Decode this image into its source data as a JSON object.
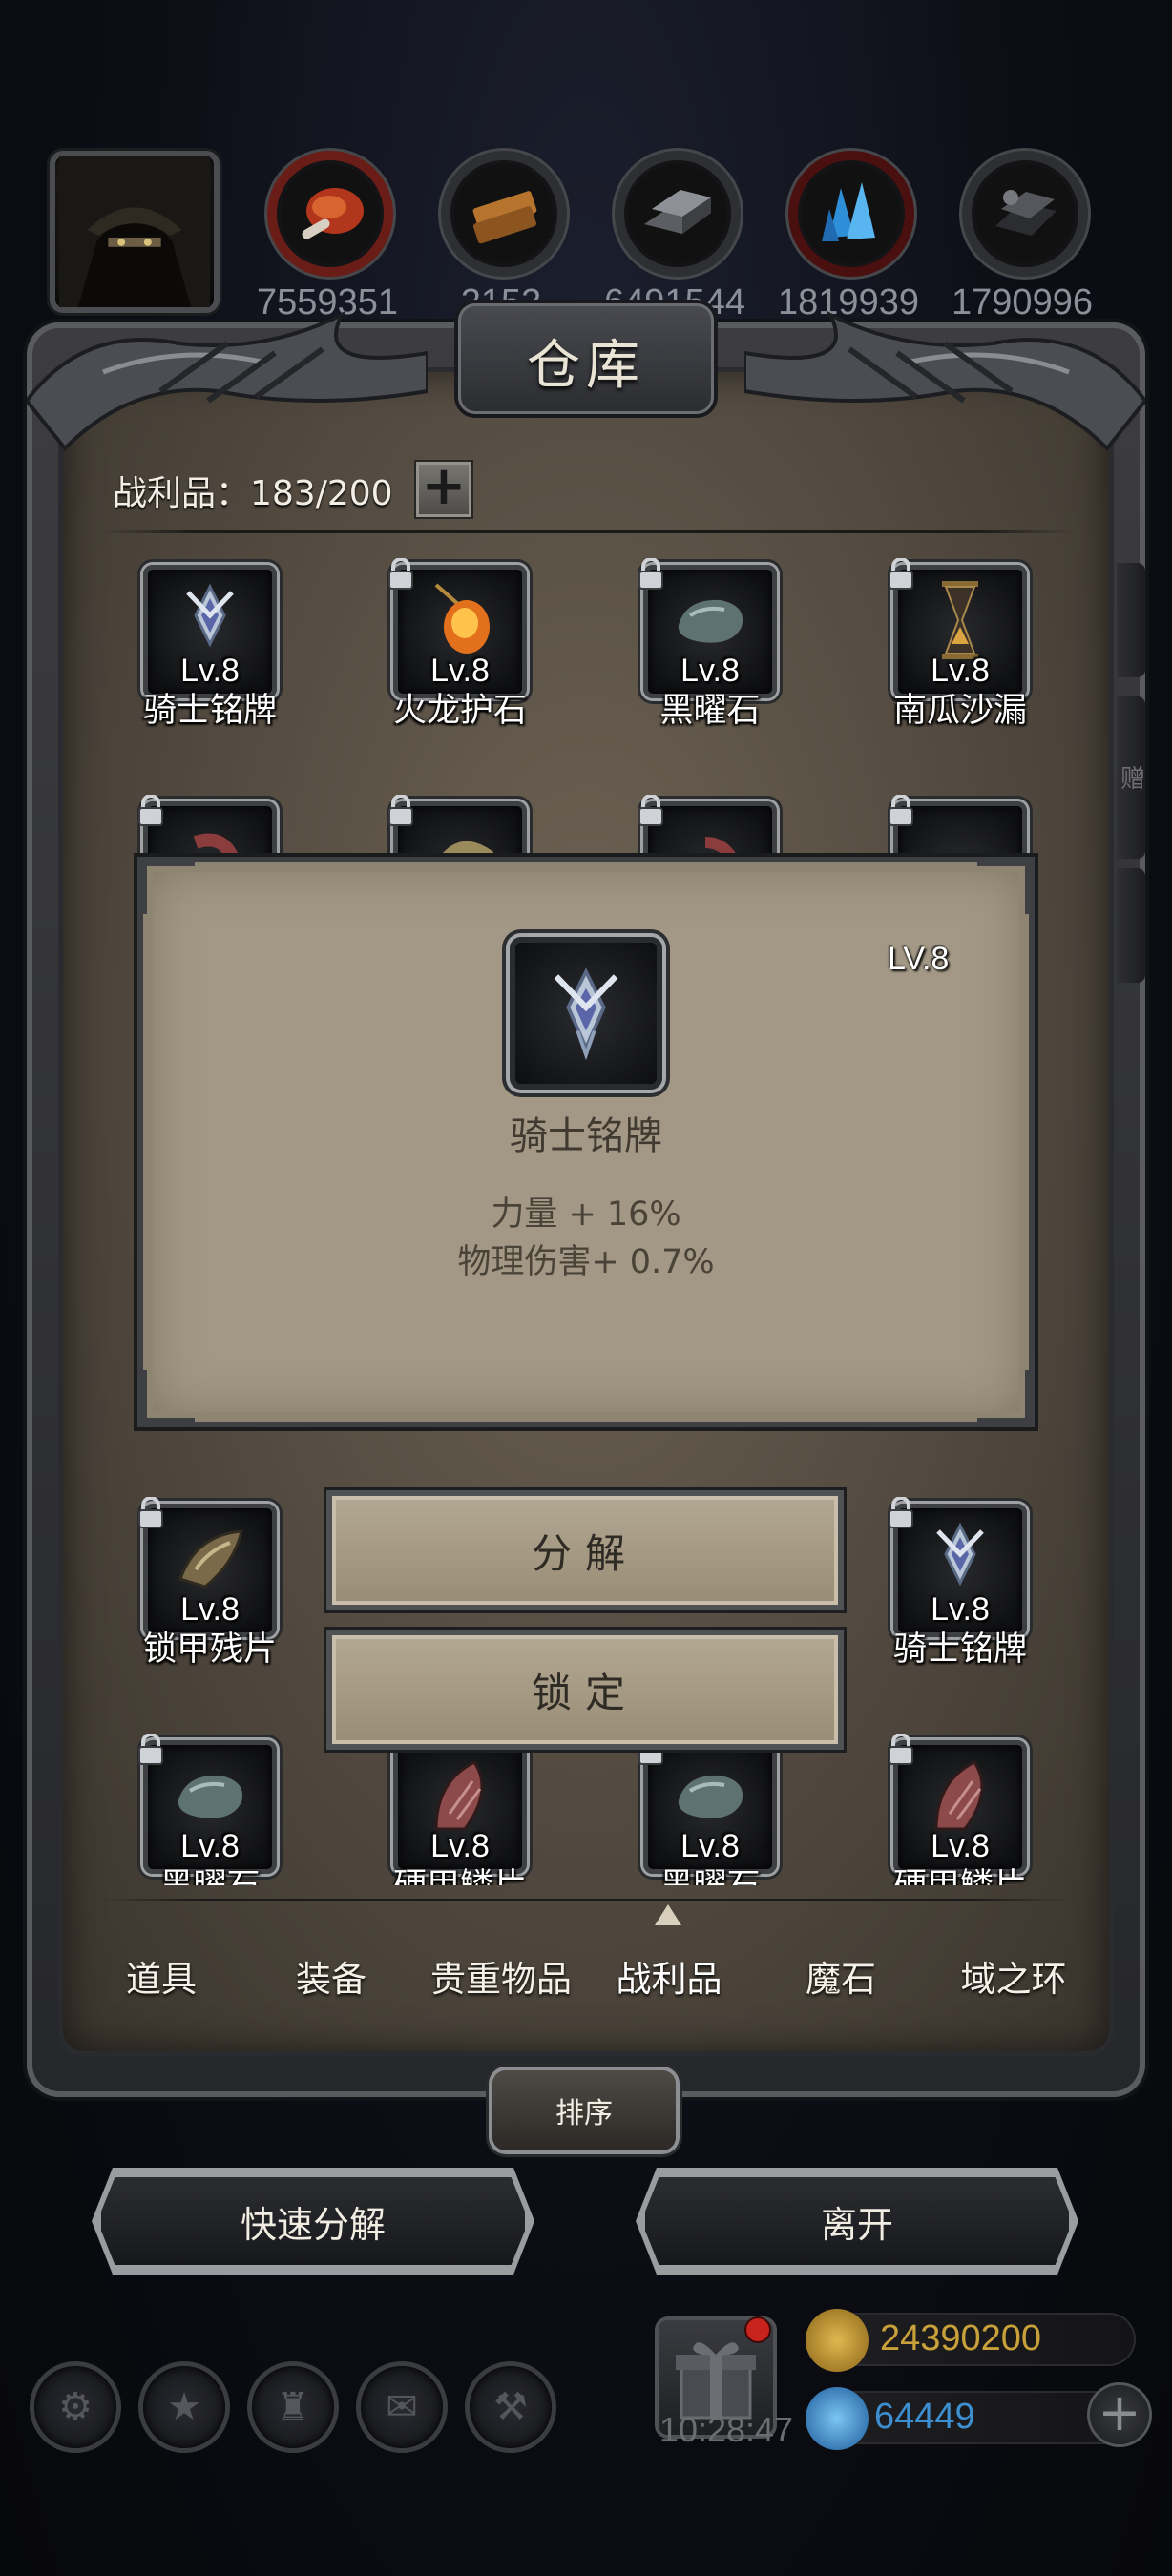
{
  "top_bar": {
    "avatar_icon": "hooded-character-portrait",
    "resources": [
      {
        "icon": "red-meat-resource-icon",
        "value": "7559351"
      },
      {
        "icon": "wood-plank-resource-icon",
        "value": "2153"
      },
      {
        "icon": "iron-ingot-resource-icon",
        "value": "6491544"
      },
      {
        "icon": "blue-crystal-resource-icon",
        "value": "1819939"
      },
      {
        "icon": "dark-ore-resource-icon",
        "value": "1790996"
      }
    ]
  },
  "warehouse": {
    "title": "仓库",
    "capacity_label": "战利品：183/200",
    "expand_symbol": "+",
    "side_tab_label": "赠"
  },
  "items": {
    "row1": [
      {
        "name": "骑士铭牌",
        "level": "Lv.8",
        "icon": "knight-badge-icon",
        "locked": false
      },
      {
        "name": "火龙护石",
        "level": "Lv.8",
        "icon": "fire-dragon-amulet-icon",
        "locked": true
      },
      {
        "name": "黑曜石",
        "level": "Lv.8",
        "icon": "obsidian-stone-icon",
        "locked": true
      },
      {
        "name": "南瓜沙漏",
        "level": "Lv.8",
        "icon": "pumpkin-hourglass-icon",
        "locked": true
      }
    ],
    "row4": [
      {
        "name": "锁甲残片",
        "level": "Lv.8",
        "icon": "chainmail-fragment-icon",
        "locked": true
      },
      {
        "name": "骑士铭牌",
        "level": "Lv.8",
        "icon": "knight-badge-icon",
        "locked": true
      }
    ],
    "row5": [
      {
        "name": "黑曜石",
        "level": "Lv.8",
        "icon": "obsidian-stone-icon",
        "locked": true
      },
      {
        "name": "硬甲鳞片",
        "level": "Lv.8",
        "icon": "hard-armor-scale-icon",
        "locked": false
      },
      {
        "name": "黑曜石",
        "level": "Lv.8",
        "icon": "obsidian-stone-icon",
        "locked": true
      },
      {
        "name": "硬甲鳞片",
        "level": "Lv.8",
        "icon": "hard-armor-scale-icon",
        "locked": true
      }
    ]
  },
  "popup": {
    "level": "LV.8",
    "name": "骑士铭牌",
    "icon": "knight-badge-icon",
    "stats": [
      "力量 + 16%",
      "物理伤害+ 0.7%"
    ]
  },
  "actions": {
    "decompose": "分解",
    "lock": "锁定"
  },
  "tabs": [
    {
      "label": "道具",
      "active": false
    },
    {
      "label": "装备",
      "active": false
    },
    {
      "label": "贵重物品",
      "active": false
    },
    {
      "label": "战利品",
      "active": true
    },
    {
      "label": "魔石",
      "active": false
    },
    {
      "label": "域之环",
      "active": false
    }
  ],
  "footer": {
    "sort_label": "排序",
    "quick_decompose_label": "快速分解",
    "leave_label": "离开"
  },
  "hud": {
    "clock": "10:28:47",
    "gold": "24390200",
    "gems": "64449",
    "gold_color": "#c9a13a",
    "gem_color": "#3d8fd0",
    "add_symbol": "+"
  }
}
